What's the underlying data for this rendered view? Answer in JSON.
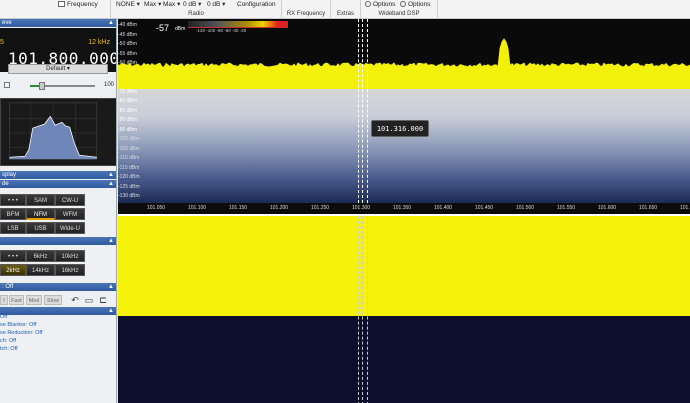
{
  "ribbon": {
    "frequency_label": "Frequency",
    "none_label": "NONE",
    "max1": "Max",
    "max2": "Max",
    "db1": "0 dB",
    "db2": "0 dB",
    "configuration": "Configuration",
    "options1": "Options",
    "options2": "Options",
    "groups": [
      "Radio",
      "RX Frequency",
      "Extras",
      "Wideband DSP"
    ]
  },
  "left": {
    "source_header": "eve",
    "step_label": "5",
    "step_value": "12 kHz",
    "frequency": "101.800.000",
    "preset": "Default",
    "volume": "100",
    "volume_level": 0.18,
    "display_header": "splay",
    "mode_header": "de",
    "modes": [
      "• • •",
      "SAM",
      "CW-U",
      "BFM",
      "NFM",
      "WFM",
      "LSB",
      "USB",
      "Wide-U"
    ],
    "active_mode": "NFM",
    "bw_header": "",
    "bandwidths": [
      "• • •",
      "6kHz",
      "10kHz",
      "2kHz",
      "14kHz",
      "16kHz"
    ],
    "agc_header": ": Off",
    "speeds": [
      "f",
      "Fast",
      "Med",
      "Slow"
    ],
    "options": [
      "Off",
      "se Blanker: Off",
      "se Reduction: Off",
      "ch: Off",
      "tch: Off"
    ]
  },
  "spectrum": {
    "level": "-57",
    "level_unit": "dBm",
    "scale_labels": "-120  -100  -80  -60  -40  -20",
    "db_labels": [
      "-40 dBm",
      "-45 dBm",
      "-50 dBm",
      "-55 dBm",
      "-60 dBm",
      "-65 dBm",
      "-70 dBm",
      "-75 dBm",
      "-80 dBm",
      "-85 dBm",
      "-90 dBm",
      "-95 dBm",
      "-100 dBm",
      "-105 dBm",
      "-110 dBm",
      "-115 dBm",
      "-120 dBm",
      "-125 dBm",
      "-130 dBm"
    ],
    "freq_labels": [
      "101.050",
      "101.100",
      "101.150",
      "101.200",
      "101.250",
      "101.300",
      "101.350",
      "101.400",
      "101.450",
      "101.500",
      "101.550",
      "101.600",
      "101.650",
      "101.700"
    ],
    "tooltip": "101.316.000"
  },
  "colors": {
    "accent": "#2e5a9e",
    "waterfall_yellow": "#f6f20a",
    "waterfall_dark": "#0b0e2c",
    "trace": "#f3f00a"
  }
}
